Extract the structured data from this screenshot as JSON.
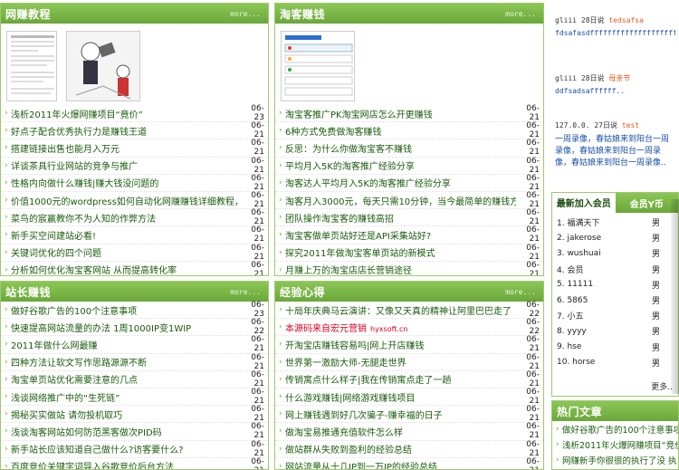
{
  "panels": [
    {
      "key": "p1",
      "title": "网赚教程",
      "more": "more...",
      "items": [
        {
          "title": "浅析2011年火爆网赚项目“竟价”",
          "date": "06-23"
        },
        {
          "title": "好点子配合优秀执行力是赚钱王道",
          "date": "06-21"
        },
        {
          "title": "搭建链接出售也能月入万元",
          "date": "06-21"
        },
        {
          "title": "详谈茶具行业网站的竞争与推广",
          "date": "06-21"
        },
        {
          "title": "性格内向做什么赚钱|赚大钱没问题的",
          "date": "06-21"
        },
        {
          "title": "价值1000元的wordpress如何自动化网赚赚钱详细教程，免",
          "date": "06-21"
        },
        {
          "title": "菜鸟的宸赢教你不为人知的作弊方法",
          "date": "06-21"
        },
        {
          "title": "新手买空间建站必看!",
          "date": "06-21"
        },
        {
          "title": "关键词优化的四个问题",
          "date": "06-21"
        },
        {
          "title": "分析如何优化淘宝客网站 从而提高转化率",
          "date": "06-21"
        }
      ]
    },
    {
      "key": "p2",
      "title": "淘客赚钱",
      "more": "more...",
      "items": [
        {
          "title": "淘宝客推广PK淘宝网店怎么开更赚钱",
          "date": "06-21"
        },
        {
          "title": "6种方式免费做淘客赚钱",
          "date": "06-21"
        },
        {
          "title": "反思：为什么你做淘宝客不赚钱",
          "date": "06-21"
        },
        {
          "title": "平均月入5K的淘客推广经验分享",
          "date": "06-21"
        },
        {
          "title": "淘客达人平均月入5K的淘客推广经验分享",
          "date": "06-21"
        },
        {
          "title": "淘客月入3000元，每天只需10分钟，当今最简单的赚钱方",
          "date": "06-21"
        },
        {
          "title": "团队操作淘宝客的赚钱高招",
          "date": "06-21"
        },
        {
          "title": "淘宝客做单页站好还是API采集站好?",
          "date": "06-21"
        },
        {
          "title": "探究2011年做淘宝客单页站的新模式",
          "date": "06-21"
        },
        {
          "title": "月赚上万的淘宝店店长营销途径",
          "date": "06-21"
        }
      ]
    },
    {
      "key": "p3",
      "title": "站长赚钱",
      "more": "more...",
      "items": [
        {
          "title": "做好谷歌广告的100个注意事项",
          "date": "06-23"
        },
        {
          "title": "快速提高网站流量的办法 1周1000IP变1WIP",
          "date": "06-22"
        },
        {
          "title": "2011年做什么网最赚",
          "date": "06-21"
        },
        {
          "title": "四种方法让软文写作思路源源不断",
          "date": "06-21"
        },
        {
          "title": "淘宝单页站优化需要注意的几点",
          "date": "06-21"
        },
        {
          "title": "浅谈网络推广中的“生死链”",
          "date": "06-21"
        },
        {
          "title": "揭秘买实做站 请勿投机取巧",
          "date": "06-21"
        },
        {
          "title": "浅谈淘客网站如何防范黑客做次PID码",
          "date": "06-21"
        },
        {
          "title": "新手站长应该知道自己做什么?访客要什么?",
          "date": "06-21"
        },
        {
          "title": "百度竞价关键字词导入谷歌竞价后台方法",
          "date": "06-21"
        }
      ]
    },
    {
      "key": "p4",
      "title": "经验心得",
      "more": "more...",
      "items": [
        {
          "title": "十局年庆典马云演讲：又像又天真的精神让阿里巴巴走了",
          "date": "06-22"
        },
        {
          "title": "本源码来自宏元营销",
          "sub": "hyxsoft.cn",
          "date": "06-22",
          "red": true
        },
        {
          "title": "开淘宝店赚钱容易吗|网上开店赚钱",
          "date": "06-21"
        },
        {
          "title": "世界第一激励大师-无腿走世界",
          "date": "06-21"
        },
        {
          "title": "传销寓点什么样子|我在传销寓点走了一趟",
          "date": "06-21"
        },
        {
          "title": "什么游戏赚钱|网络游戏赚钱项目",
          "date": "06-21"
        },
        {
          "title": "网上赚钱遇到好几次骗子-赚幸福的日子",
          "date": "06-21"
        },
        {
          "title": "做淘宝易推通充值软件怎么样",
          "date": "06-21"
        },
        {
          "title": "做站群从失败到盈利的经验总结",
          "date": "06-21"
        },
        {
          "title": "网站流量从十几IP到一万IP的经验总结",
          "date": "06-21"
        }
      ]
    }
  ],
  "comments": [
    {
      "who": "gliii 28日说",
      "what": "tedsafsa",
      "body": "fdsafasdffffffffffffffffffff"
    },
    {
      "who": "gliii 28日说",
      "what": "母亲节",
      "body": "ddfsadsaffffff.."
    },
    {
      "who": "127.0.0. 27日说",
      "what": "test",
      "body": "一周录像，春姑娘来到阳台一周录像，春姑娘来到阳台一周录像，春姑娘来到阳台一周录像.."
    }
  ],
  "members": {
    "tab_active": "最新加入会员",
    "tab_inactive": "会员Y币",
    "list": [
      {
        "name": "1. 福满天下",
        "gender": "男"
      },
      {
        "name": "2. jakerose",
        "gender": "男"
      },
      {
        "name": "3. wushuai",
        "gender": "男"
      },
      {
        "name": "4. 会员",
        "gender": "男"
      },
      {
        "name": "5. 11111",
        "gender": "男"
      },
      {
        "name": "6. 5865",
        "gender": "男"
      },
      {
        "name": "7. 小五",
        "gender": "男"
      },
      {
        "name": "8. yyyy",
        "gender": "男"
      },
      {
        "name": "9. hse",
        "gender": "男"
      },
      {
        "name": "10. horse",
        "gender": "男"
      }
    ],
    "more": "更多.."
  },
  "hot": {
    "title": "热门文章",
    "items": [
      {
        "title": "做好谷歌广告的100个注意事项"
      },
      {
        "title": "浅析2011年火爆网赚项目“竞价”"
      },
      {
        "title": "网赚新手你很很的执行了没 执"
      }
    ]
  }
}
